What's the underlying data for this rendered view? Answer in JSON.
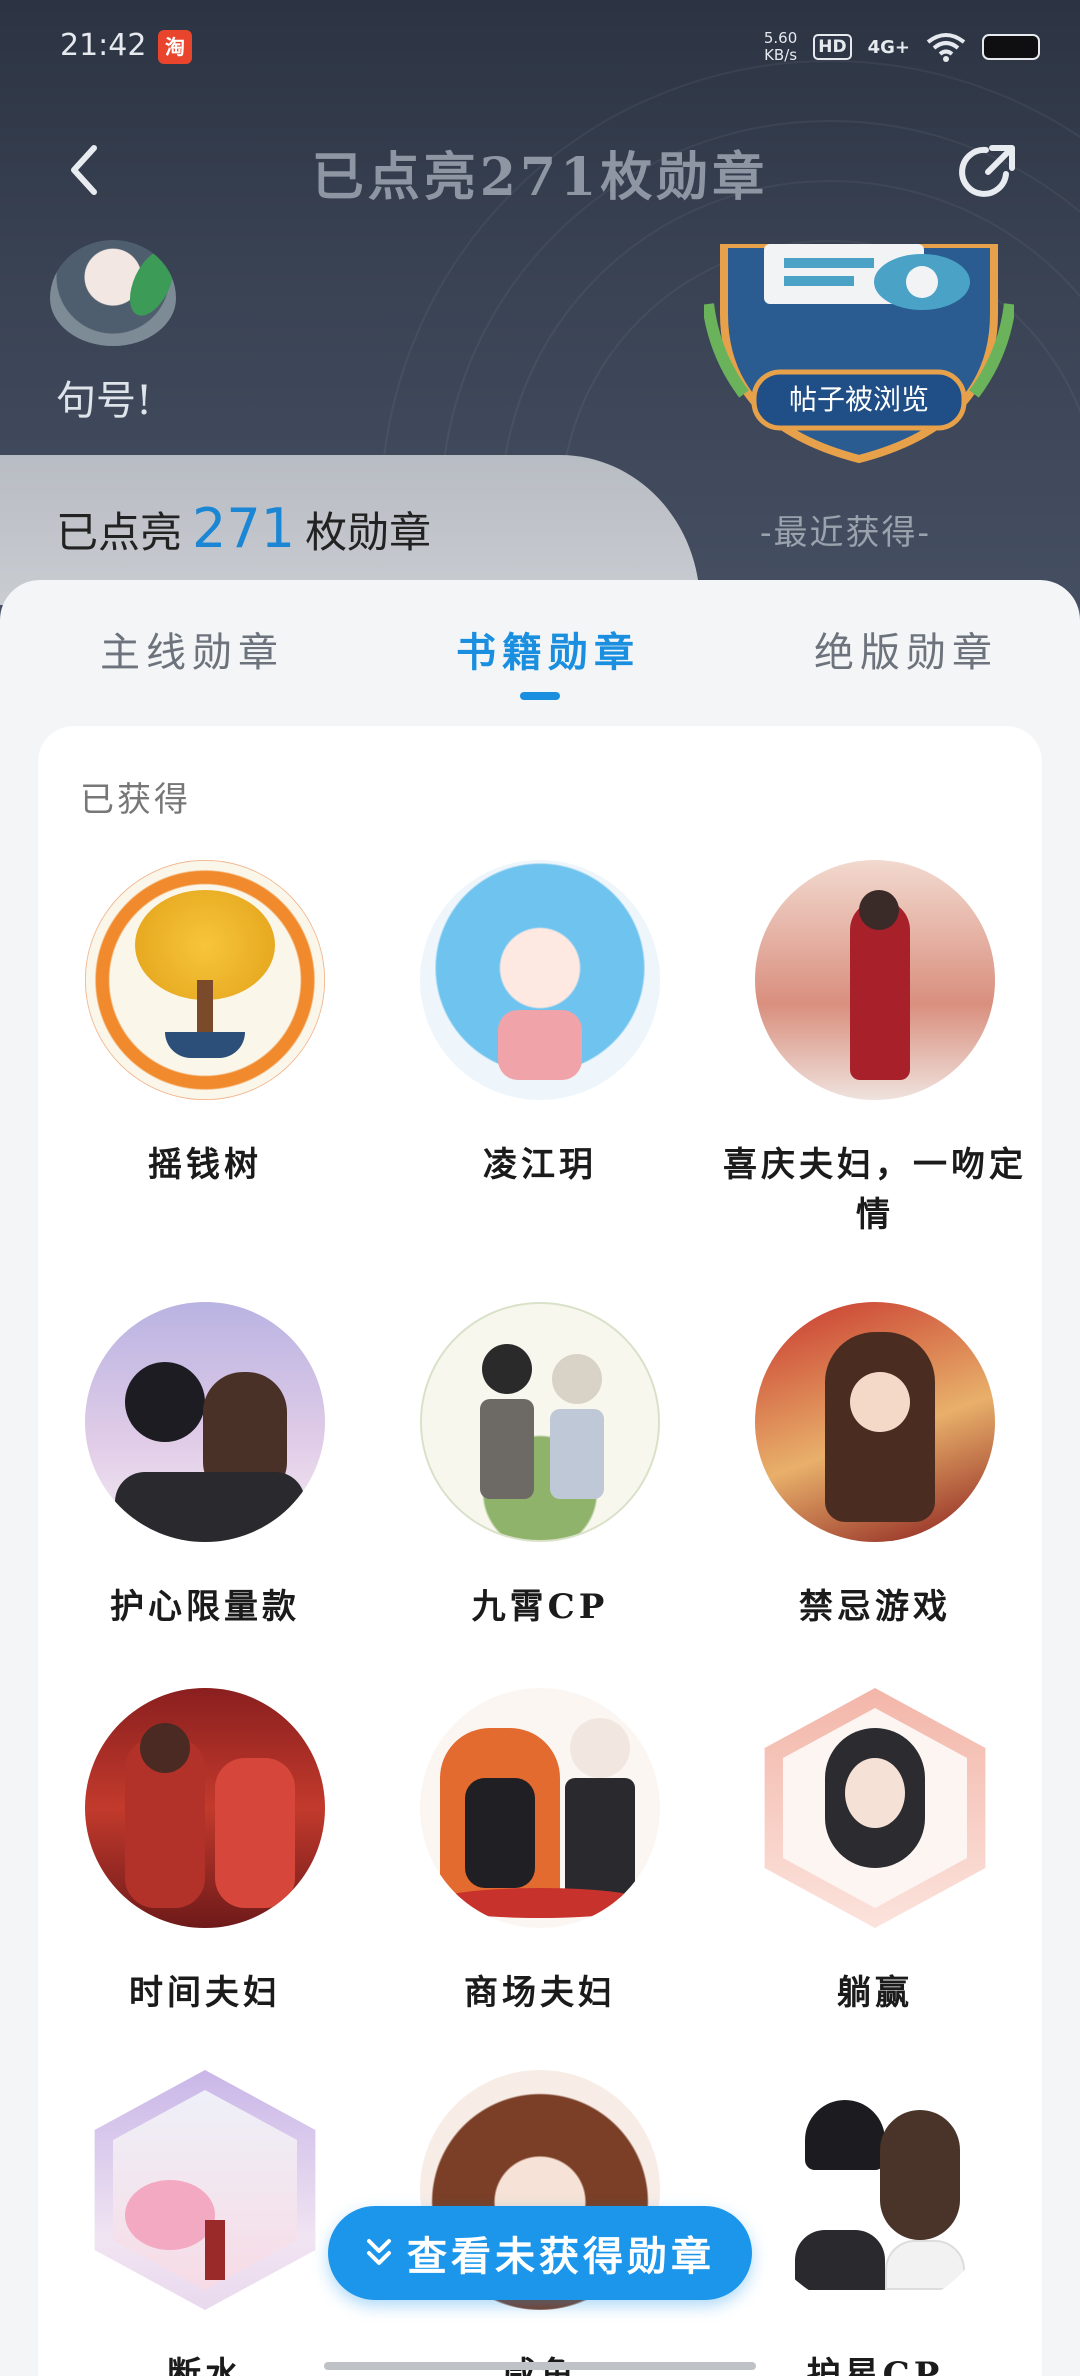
{
  "status_bar": {
    "time": "21:42",
    "app_icon_text": "淘",
    "net_speed_value": "5.60",
    "net_speed_unit": "KB/s",
    "hd_label": "HD",
    "signal_label": "4G+"
  },
  "header": {
    "title": "已点亮271枚勋章",
    "nickname": "句号!",
    "recent_badge_label": "帖子被浏览",
    "recent_caption": "-最近获得-",
    "count_prefix": "已点亮",
    "count_value": "271",
    "count_suffix": "枚勋章"
  },
  "tabs": [
    {
      "label": "主线勋章",
      "active": false
    },
    {
      "label": "书籍勋章",
      "active": true
    },
    {
      "label": "绝版勋章",
      "active": false
    }
  ],
  "panel": {
    "title": "已获得"
  },
  "medals": [
    {
      "name": "摇钱树",
      "icon": "money-tree-icon"
    },
    {
      "name": "凌江玥",
      "icon": "blue-hair-girl-icon"
    },
    {
      "name": "喜庆夫妇，一吻定情",
      "icon": "red-robe-couple-icon"
    },
    {
      "name": "护心限量款",
      "icon": "couple-portrait-icon"
    },
    {
      "name": "九霄CP",
      "icon": "boys-garden-icon"
    },
    {
      "name": "禁忌游戏",
      "icon": "red-dress-girl-icon"
    },
    {
      "name": "时间夫妇",
      "icon": "wedding-couple-icon"
    },
    {
      "name": "商场夫妇",
      "icon": "royal-couple-icon"
    },
    {
      "name": "躺赢",
      "icon": "hanfu-girl-icon"
    },
    {
      "name": "断水",
      "icon": "pavilion-icon"
    },
    {
      "name": "咸鱼",
      "icon": "brown-hair-girl-icon"
    },
    {
      "name": "护星CP",
      "icon": "casual-couple-icon"
    }
  ],
  "fab": {
    "label": "查看未获得勋章"
  },
  "colors": {
    "accent": "#1a8fe0",
    "header_bg": "#2c3443"
  }
}
